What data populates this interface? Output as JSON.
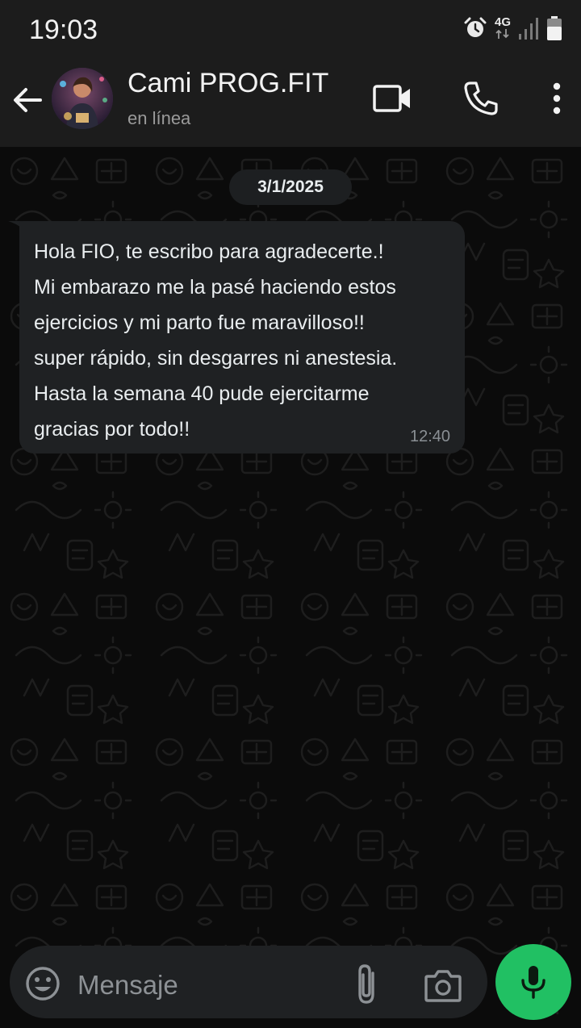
{
  "status_bar": {
    "time": "19:03",
    "network": "4G",
    "icons": [
      "alarm-icon",
      "network-4g-icon",
      "signal-icon",
      "battery-icon"
    ]
  },
  "header": {
    "contact_name": "Cami PROG.FIT",
    "contact_status": "en línea",
    "icons": [
      "back-arrow-icon",
      "video-call-icon",
      "phone-icon",
      "more-options-icon"
    ]
  },
  "chat": {
    "date_chip": "3/1/2025",
    "messages": [
      {
        "text": "Hola FIO, te escribo para agradecerte.!\nMi embarazo me la pasé haciendo estos\nejercicios y mi parto fue maravilloso!!\nsuper rápido, sin desgarres ni anestesia.\nHasta la semana 40 pude ejercitarme\ngracias por todo!!",
        "time": "12:40"
      }
    ]
  },
  "input_bar": {
    "placeholder": "Mensaje",
    "value": "",
    "icons": [
      "emoji-icon",
      "attach-icon",
      "camera-icon",
      "mic-icon"
    ]
  },
  "colors": {
    "header_bg": "#1c1c1c",
    "chat_bg": "#0b0b0b",
    "bubble_bg": "#1f2123",
    "accent_green": "#21c063",
    "text_primary": "#e9edef",
    "text_secondary": "#9a9a9a"
  }
}
